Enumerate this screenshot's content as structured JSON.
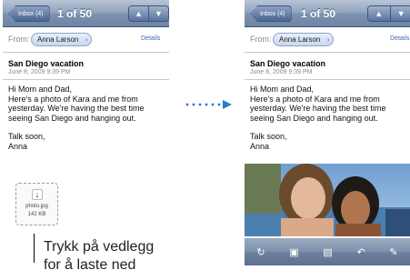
{
  "left_screen": {
    "nav": {
      "back_label": "Inbox (4)",
      "counter": "1 of 50",
      "prev_icon": "up-triangle-icon",
      "next_icon": "down-triangle-icon"
    },
    "from_label": "From:",
    "sender": "Anna Larson",
    "details_label": "Details",
    "subject": "San Diego vacation",
    "date": "June 8, 2009 9:39 PM",
    "body_lines": [
      "Hi Mom and Dad,",
      "Here's a photo of Kara and me from",
      "yesterday. We're having the best time",
      "seeing San Diego and hanging out."
    ],
    "signoff_lines": [
      "Talk soon,",
      "Anna"
    ],
    "attachment": {
      "icon": "download-arrow-icon",
      "filename": "photo.jpg",
      "size": "142 KB"
    }
  },
  "right_screen": {
    "nav": {
      "back_label": "Inbox (4)",
      "counter": "1 of 50",
      "prev_icon": "up-triangle-icon",
      "next_icon": "down-triangle-icon"
    },
    "from_label": "From:",
    "sender": "Anna Larson",
    "details_label": "Details",
    "subject": "San Diego vacation",
    "date": "June 8, 2009 9:39 PM",
    "body_lines": [
      "Hi Mom and Dad,",
      "Here's a photo of Kara and me from",
      "yesterday. We're having the best time",
      "seeing San Diego and hanging out."
    ],
    "signoff_lines": [
      "Talk soon,",
      "Anna"
    ],
    "toolbar_icons": [
      "refresh-icon",
      "move-to-folder-icon",
      "trash-icon",
      "reply-icon",
      "compose-icon"
    ]
  },
  "callout": {
    "lines": [
      "Trykk på vedlegg",
      "for å laste ned"
    ]
  },
  "colors": {
    "nav_bar": "#7f93af",
    "link": "#3a68b8",
    "arrow_dots": "#1c7fd4"
  }
}
